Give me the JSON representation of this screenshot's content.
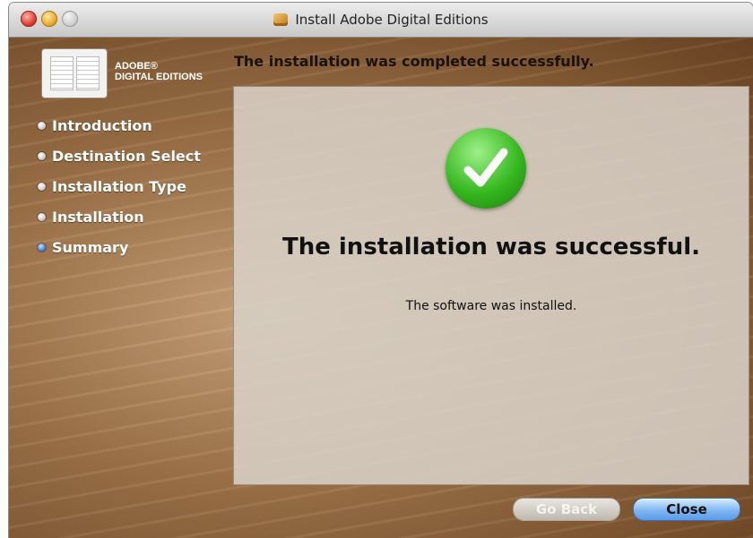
{
  "window": {
    "title": "Install Adobe Digital Editions"
  },
  "brand": {
    "line1": "ADOBE®",
    "line2": "DIGITAL EDITIONS"
  },
  "sidebar": {
    "steps": [
      {
        "label": "Introduction",
        "active": false
      },
      {
        "label": "Destination Select",
        "active": false
      },
      {
        "label": "Installation Type",
        "active": false
      },
      {
        "label": "Installation",
        "active": false
      },
      {
        "label": "Summary",
        "active": true
      }
    ]
  },
  "main": {
    "headline": "The installation was completed successfully.",
    "success_title": "The installation was successful.",
    "success_message": "The software was installed."
  },
  "buttons": {
    "go_back": "Go Back",
    "close": "Close"
  },
  "colors": {
    "active_step": "#3f7fe0",
    "success_green": "#36b81f",
    "default_button": "#5a9ae6"
  }
}
